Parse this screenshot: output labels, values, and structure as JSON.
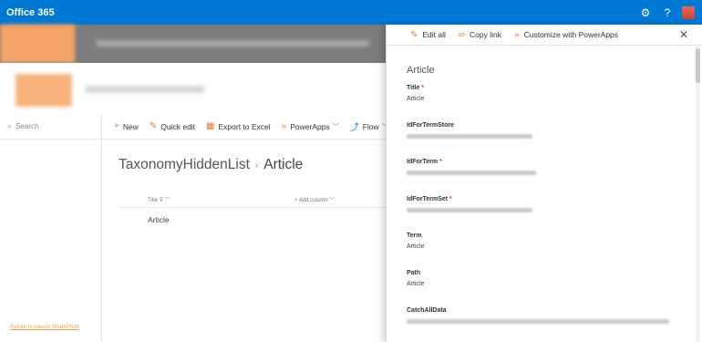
{
  "suite_bar": {
    "brand": "Office 365",
    "icons": [
      "gear-icon",
      "help-icon",
      "avatar"
    ]
  },
  "left_nav": {
    "search_placeholder": "Search",
    "return_link": "Return to classic SharePoint"
  },
  "command_bar": {
    "new": "New",
    "quick_edit": "Quick edit",
    "export": "Export to Excel",
    "powerapps": "PowerApps",
    "flow": "Flow"
  },
  "list": {
    "breadcrumb_parent": "TaxonomyHiddenList",
    "breadcrumb_current": "Article",
    "col_title": "Title",
    "col_add": "+ Add column",
    "rows": [
      "Article"
    ]
  },
  "panel": {
    "toolbar": {
      "edit_all": "Edit all",
      "copy_link": "Copy link",
      "customize": "Customize with PowerApps"
    },
    "title": "Article",
    "fields": [
      {
        "label": "Title",
        "required": "*",
        "value": "Article"
      },
      {
        "label": "IdForTermStore",
        "required": "",
        "value": ""
      },
      {
        "label": "IdForTerm",
        "required": "*",
        "value": ""
      },
      {
        "label": "IdForTermSet",
        "required": "*",
        "value": ""
      },
      {
        "label": "Term",
        "required": "",
        "value": "Article"
      },
      {
        "label": "Path",
        "required": "",
        "value": "Article"
      },
      {
        "label": "CatchAllData",
        "required": "",
        "value": ""
      }
    ]
  },
  "colors": {
    "suite_blue": "#0078d4",
    "accent_orange": "#e07b39",
    "required_red": "#d13438"
  }
}
